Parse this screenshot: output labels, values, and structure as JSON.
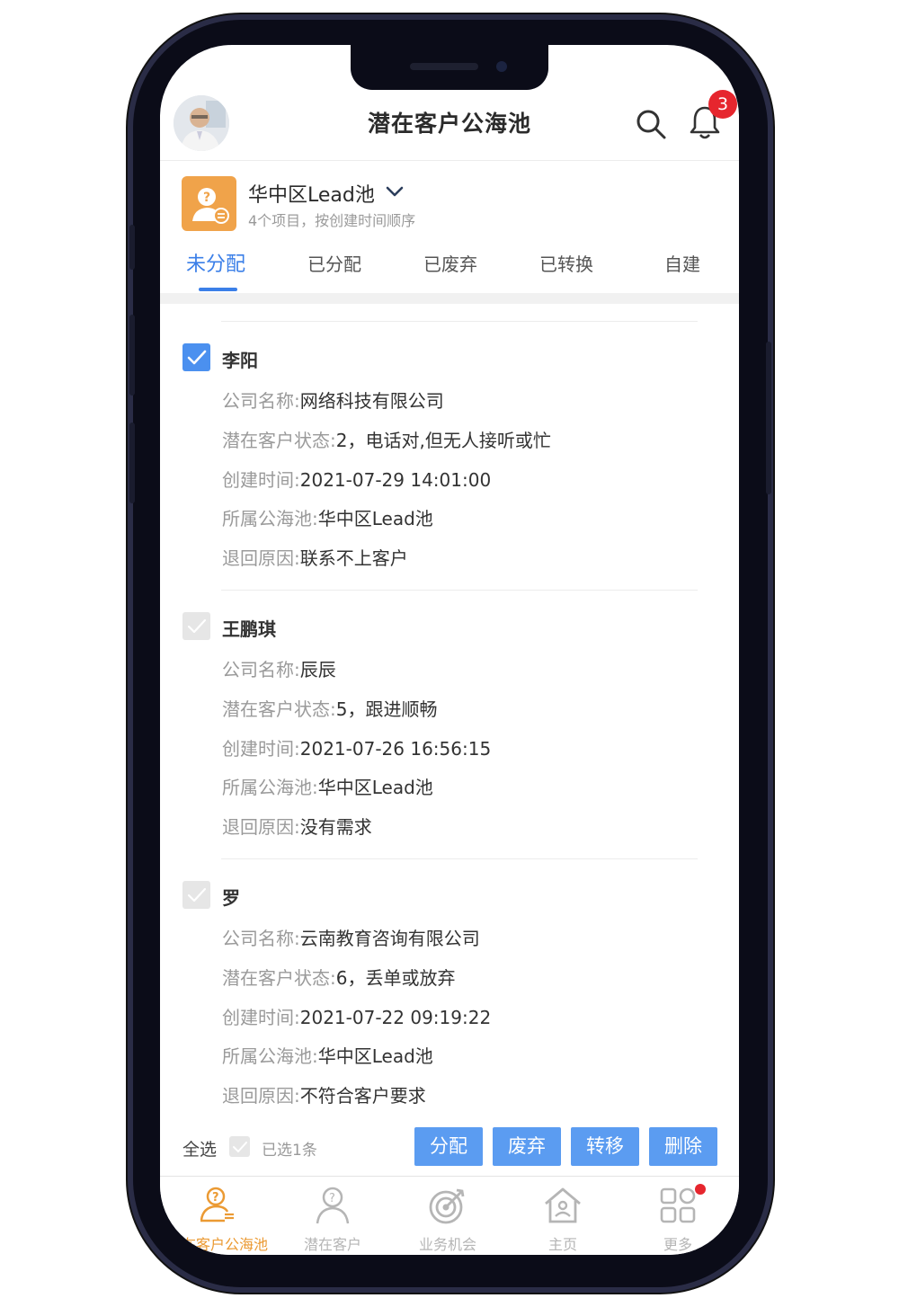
{
  "header": {
    "title": "潜在客户公海池",
    "notification_count": "3",
    "icons": [
      "avatar",
      "search-icon",
      "bell-icon"
    ]
  },
  "pool": {
    "name": "华中区Lead池",
    "subtitle": "4个项目，按创建时间顺序",
    "icon": "lead-pool-icon"
  },
  "tabs": [
    {
      "label": "未分配",
      "active": true
    },
    {
      "label": "已分配",
      "active": false
    },
    {
      "label": "已废弃",
      "active": false
    },
    {
      "label": "已转换",
      "active": false
    },
    {
      "label": "自建",
      "active": false
    }
  ],
  "labels": {
    "company": "公司名称:",
    "status": "潜在客户状态:",
    "created": "创建时间:",
    "pool": "所属公海池:",
    "reason": "退回原因:"
  },
  "leads": [
    {
      "name": "李阳",
      "checked": true,
      "company": "网络科技有限公司",
      "status": "2，电话对,但无人接听或忙",
      "created": "2021-07-29 14:01:00",
      "pool": "华中区Lead池",
      "reason": "联系不上客户"
    },
    {
      "name": "王鹏琪",
      "checked": false,
      "company": "辰辰",
      "status": "5，跟进顺畅",
      "created": "2021-07-26 16:56:15",
      "pool": "华中区Lead池",
      "reason": "没有需求"
    },
    {
      "name": "罗",
      "checked": false,
      "company": "云南教育咨询有限公司",
      "status": "6，丢单或放弃",
      "created": "2021-07-22 09:19:22",
      "pool": "华中区Lead池",
      "reason": "不符合客户要求"
    }
  ],
  "actions": {
    "select_all": "全选",
    "selected_count": "已选1条",
    "buttons": [
      "分配",
      "废弃",
      "转移",
      "删除"
    ]
  },
  "nav": [
    {
      "label": "潜在客户公海池",
      "icon": "lead-pool-icon",
      "active": true
    },
    {
      "label": "潜在客户",
      "icon": "person-icon",
      "active": false
    },
    {
      "label": "业务机会",
      "icon": "target-icon",
      "active": false
    },
    {
      "label": "主页",
      "icon": "home-icon",
      "active": false
    },
    {
      "label": "更多",
      "icon": "grid-icon",
      "active": false
    }
  ],
  "colors": {
    "accent_blue": "#3b7fe8",
    "button_blue": "#5b9cf1",
    "active_orange": "#eb9a33",
    "badge_red": "#e6262e"
  }
}
